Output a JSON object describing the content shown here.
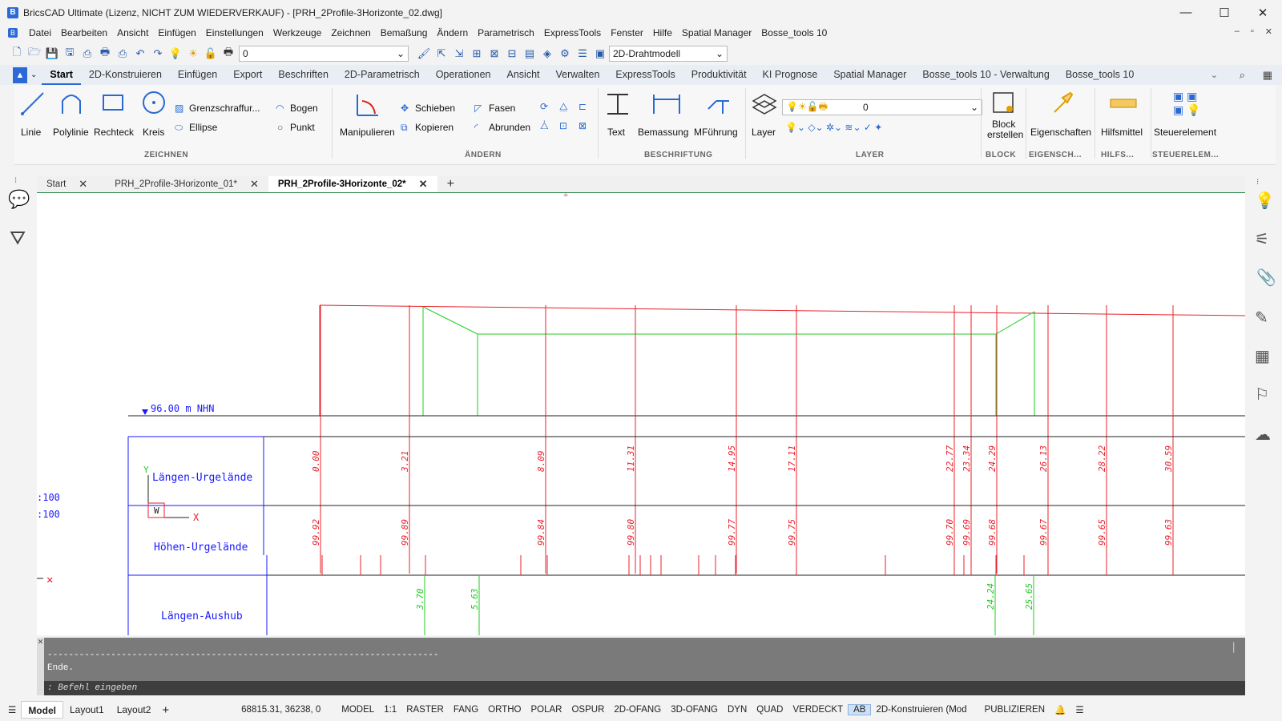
{
  "window": {
    "title": "BricsCAD Ultimate (Lizenz, NICHT ZUM WIEDERVERKAUF) - [PRH_2Profile-3Horizonte_02.dwg]",
    "logo": "B",
    "min": "—",
    "max": "☐",
    "close": "✕"
  },
  "menu": [
    "Datei",
    "Bearbeiten",
    "Ansicht",
    "Einfügen",
    "Einstellungen",
    "Werkzeuge",
    "Zeichnen",
    "Bemaßung",
    "Ändern",
    "Parametrisch",
    "ExpressTools",
    "Fenster",
    "Hilfe",
    "Spatial Manager",
    "Bosse_tools 10"
  ],
  "menu_controls": {
    "min": "–",
    "restore": "▫",
    "close": "✕"
  },
  "qat": {
    "layer_value": "0",
    "visual_style": "2D-Drahtmodell"
  },
  "ribbon_tabs": [
    "Start",
    "2D-Konstruieren",
    "Einfügen",
    "Export",
    "Beschriften",
    "2D-Parametrisch",
    "Operationen",
    "Ansicht",
    "Verwalten",
    "ExpressTools",
    "Produktivität",
    "KI Prognose",
    "Spatial Manager",
    "Bosse_tools 10 - Verwaltung",
    "Bosse_tools 10"
  ],
  "ribbon": {
    "zeichnen": {
      "linie": "Linie",
      "polylinie": "Polylinie",
      "rechteck": "Rechteck",
      "kreis": "Kreis",
      "grenz": "Grenzschraffur...",
      "ellipse": "Ellipse",
      "bogen": "Bogen",
      "punkt": "Punkt",
      "group": "ZEICHNEN"
    },
    "aendern": {
      "manipulieren": "Manipulieren",
      "schieben": "Schieben",
      "kopieren": "Kopieren",
      "fasen": "Fasen",
      "abrunden": "Abrunden",
      "group": "ÄNDERN"
    },
    "beschriftung": {
      "text": "Text",
      "bemassung": "Bemassung",
      "mfuehrung": "MFührung",
      "group": "BESCHRIFTUNG"
    },
    "layer": {
      "layer": "Layer",
      "value": "0",
      "group": "LAYER"
    },
    "block": {
      "label1": "Block",
      "label2": "erstellen",
      "group": "BLOCK"
    },
    "eig": {
      "label": "Eigenschaften",
      "group": "EIGENSCH..."
    },
    "hilfs": {
      "label": "Hilfsmittel",
      "group": "HILFS..."
    },
    "steuer": {
      "label": "Steuerelement",
      "group": "STEUERELEM..."
    }
  },
  "doc_tabs": [
    "Start",
    "PRH_2Profile-3Horizonte_01*",
    "PRH_2Profile-3Horizonte_02*"
  ],
  "drawing": {
    "nhn": "96.00 m NHN",
    "scale1": ":100",
    "scale2": ":100",
    "row_labels": [
      "Längen-Urgelände",
      "Höhen-Urgelände",
      "Längen-Aushub"
    ],
    "ucs_y": "Y",
    "ucs_w": "W",
    "ucs_x": "X",
    "laengen": [
      "0.00",
      "3.21",
      "8.09",
      "11.31",
      "14.95",
      "17.11",
      "22.77",
      "23.34",
      "24.29",
      "26.13",
      "28.22",
      "30.59"
    ],
    "hoehen": [
      "99.92",
      "99.89",
      "99.84",
      "99.80",
      "99.77",
      "99.75",
      "99.70",
      "99.69",
      "99.68",
      "99.67",
      "99.65",
      "99.63"
    ],
    "aushub": [
      "3.70",
      "5.63",
      "24.24",
      "25.65"
    ]
  },
  "command": {
    "line": "--------------------------------------------------------------------------",
    "ende": "Ende.",
    "prompt": ": Befehl eingeben"
  },
  "status": {
    "layouts": [
      "Model",
      "Layout1",
      "Layout2"
    ],
    "coords": "68815.31, 36238, 0",
    "items": [
      "MODEL",
      "1:1",
      "RASTER",
      "FANG",
      "ORTHO",
      "POLAR",
      "OSPUR",
      "2D-OFANG",
      "3D-OFANG",
      "DYN",
      "QUAD",
      "VERDECKT",
      "AB",
      "2D-Konstruieren (Mod",
      "PUBLIZIEREN"
    ]
  },
  "colors": {
    "accent": "#2b6ad6",
    "profile_red": "#e8202a",
    "profile_green": "#22cc22",
    "label_blue": "#1a1aff",
    "dim_red": "#e8202a"
  }
}
